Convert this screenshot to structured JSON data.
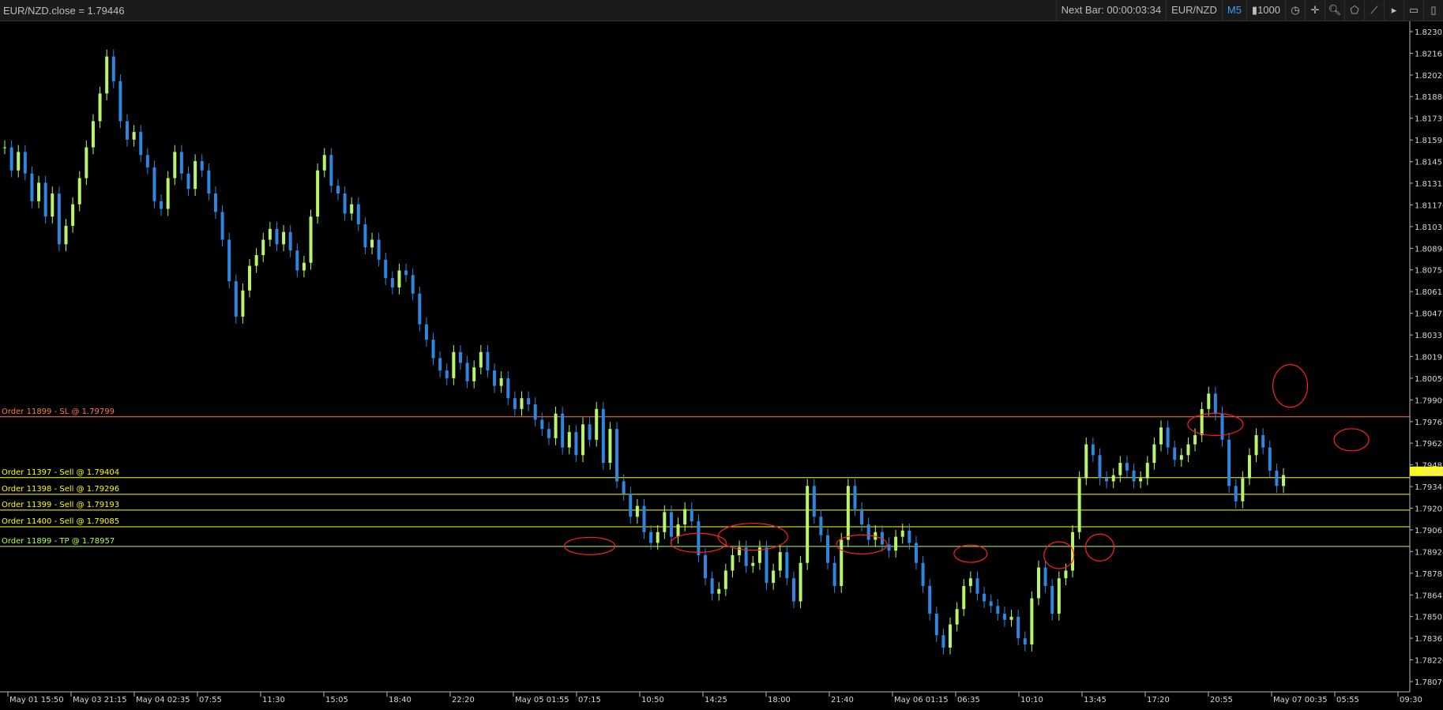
{
  "topbar": {
    "title": "EUR/NZD.close = 1.79446",
    "next_bar": "Next Bar: 00:00:03:34",
    "symbol": "EUR/NZD",
    "timeframe": "M5",
    "volume": "1000",
    "icons": [
      "clock-icon",
      "crosshair-icon",
      "zoom-icon",
      "pentagon-icon",
      "trendline-icon",
      "next-icon",
      "disabled-icon",
      "panel-icon"
    ]
  },
  "price_axis": {
    "ticks": [
      "1.82302",
      "1.82161",
      "1.82020",
      "1.81880",
      "1.81739",
      "1.81598",
      "1.81457",
      "1.81317",
      "1.81176",
      "1.81035",
      "1.80894",
      "1.80754",
      "1.80613",
      "1.80472",
      "1.80331",
      "1.80191",
      "1.80050",
      "1.79909",
      "1.79768",
      "1.79628",
      "1.79487",
      "1.79346",
      "1.79205",
      "1.79065",
      "1.78924",
      "1.78783",
      "1.78642",
      "1.78502",
      "1.78361",
      "1.78220",
      "1.78079"
    ],
    "current_price": "1.79445"
  },
  "time_axis": {
    "ticks": [
      "May 01 15:50",
      "May 03 21:15",
      "May 04 02:35",
      "07:55",
      "11:30",
      "15:05",
      "18:40",
      "22:20",
      "May 05 01:55",
      "07:15",
      "10:50",
      "14:25",
      "18:00",
      "21:40",
      "May 06 01:15",
      "06:35",
      "10:10",
      "13:45",
      "17:20",
      "20:55",
      "May 07 00:35",
      "05:55",
      "09:30"
    ]
  },
  "orders": [
    {
      "label": "Order 11899 - SL @ 1.79799",
      "price": 1.79799,
      "color": "#ff7a45"
    },
    {
      "label": "Order 11397 - Sell @ 1.79404",
      "price": 1.79404,
      "color": "#ffff00"
    },
    {
      "label": "Order 11398 - Sell @ 1.79296",
      "price": 1.79296,
      "color": "#ffff00"
    },
    {
      "label": "Order 11399 - Sell @ 1.79193",
      "price": 1.79193,
      "color": "#ffff00"
    },
    {
      "label": "Order 11400 - Sell @ 1.79085",
      "price": 1.79085,
      "color": "#ffff00"
    },
    {
      "label": "Order 11899 - TP @ 1.78957",
      "price": 1.78957,
      "color": "#b7ff4a"
    }
  ],
  "chart_data": {
    "type": "line",
    "symbol": "EUR/NZD",
    "timeframe": "M5",
    "ylim": [
      1.78079,
      1.82302
    ],
    "colors": {
      "up": "#b8f56a",
      "down": "#2f86e0",
      "sl": "#ff7a45",
      "order": "#ffff00",
      "tp": "#b7ff4a",
      "marker": "#ff2020"
    },
    "series": [
      {
        "values": [
          1.8155,
          1.814,
          1.8152,
          1.8138,
          1.812,
          1.8132,
          1.811,
          1.8125,
          1.8092,
          1.8104,
          1.8118,
          1.8135,
          1.8155,
          1.8172,
          1.819,
          1.8214,
          1.8198,
          1.8172,
          1.816,
          1.8165,
          1.815,
          1.8142,
          1.812,
          1.8115,
          1.8135,
          1.8152,
          1.8138,
          1.8128,
          1.8146,
          1.814,
          1.8125,
          1.8113,
          1.8095,
          1.8068,
          1.8045,
          1.8062,
          1.8078,
          1.8085,
          1.8095,
          1.8102,
          1.8092,
          1.81,
          1.8088,
          1.8075,
          1.808,
          1.811,
          1.814,
          1.815,
          1.813,
          1.8125,
          1.8112,
          1.8118,
          1.8105,
          1.809,
          1.8095,
          1.8082,
          1.807,
          1.8064,
          1.8075,
          1.8072,
          1.806,
          1.804,
          1.803,
          1.8018,
          1.801,
          1.8005,
          1.8022,
          1.8015,
          1.8003,
          1.8012,
          1.8022,
          1.801,
          1.8,
          1.8005,
          1.7992,
          1.7985,
          1.7992,
          1.7988,
          1.7978,
          1.7972,
          1.7966,
          1.7982,
          1.796,
          1.797,
          1.7955,
          1.7975,
          1.7965,
          1.7985,
          1.795,
          1.7972,
          1.7938,
          1.793,
          1.7915,
          1.7922,
          1.7905,
          1.7898,
          1.7905,
          1.7918,
          1.7902,
          1.791,
          1.792,
          1.7912,
          1.789,
          1.7875,
          1.7865,
          1.7868,
          1.788,
          1.789,
          1.7895,
          1.7883,
          1.7885,
          1.7895,
          1.7872,
          1.788,
          1.7892,
          1.7875,
          1.786,
          1.7885,
          1.7935,
          1.7915,
          1.7903,
          1.7885,
          1.787,
          1.79,
          1.7935,
          1.792,
          1.791,
          1.79,
          1.7905,
          1.7897,
          1.7893,
          1.7902,
          1.7906,
          1.7898,
          1.7885,
          1.787,
          1.7852,
          1.7838,
          1.783,
          1.7845,
          1.7855,
          1.787,
          1.7875,
          1.7865,
          1.786,
          1.7857,
          1.7852,
          1.7848,
          1.785,
          1.7836,
          1.7832,
          1.7862,
          1.7882,
          1.787,
          1.7852,
          1.7875,
          1.788,
          1.7905,
          1.794,
          1.7962,
          1.7955,
          1.794,
          1.7938,
          1.7942,
          1.795,
          1.7945,
          1.7938,
          1.794,
          1.795,
          1.7962,
          1.7973,
          1.796,
          1.7952,
          1.7955,
          1.7962,
          1.7968,
          1.7985,
          1.7995,
          1.7982,
          1.7965,
          1.7935,
          1.7925,
          1.794,
          1.7955,
          1.7968,
          1.796,
          1.7945,
          1.7935,
          1.7942
        ]
      }
    ],
    "markers": [
      "ellipse",
      "ellipse",
      "ellipse",
      "ellipse",
      "ellipse",
      "ellipse",
      "ellipse",
      "ellipse",
      "ellipse"
    ]
  }
}
